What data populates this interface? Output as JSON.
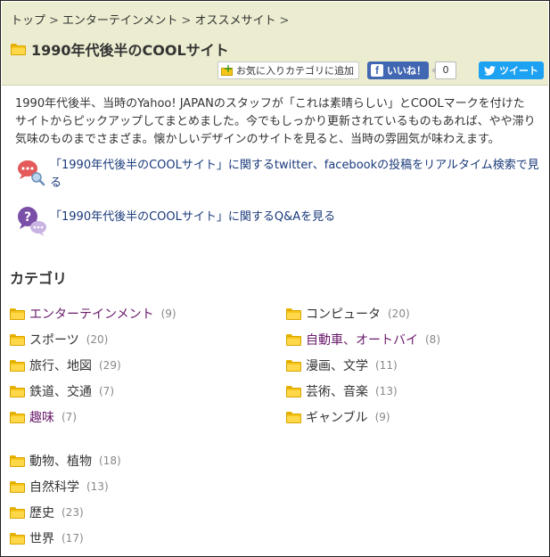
{
  "breadcrumb": {
    "items": [
      "トップ",
      "エンターテインメント",
      "オススメサイト"
    ],
    "separator": ">"
  },
  "page": {
    "title": "1990年代後半のCOOLサイト"
  },
  "toolbar": {
    "favorite_label": "お気に入りカテゴリに追加",
    "like_label": "いいね！",
    "like_count": "0",
    "tweet_label": "ツイート"
  },
  "description": {
    "lines": [
      "1990年代後半、当時のYahoo! JAPANのスタッフが「これは素晴らしい」とCOOLマークを付けた",
      "サイトからピックアップしてまとめました。今でもしっかり更新されているものもあれば、やや滞り",
      "気味のものまでさまざま。懐かしいデザインのサイトを見ると、当時の雰囲気が味わえます。"
    ]
  },
  "links": {
    "realtime_search": {
      "line1": "「1990年代後半のCOOLサイト」に関するtwitter、facebookの投稿をリアルタイム検索で見",
      "line2": "る"
    },
    "qa": "「1990年代後半のCOOLサイト」に関するQ&Aを見る"
  },
  "categories": {
    "heading": "カテゴリ",
    "left": [
      {
        "label": "エンターテインメント",
        "count": "(9)",
        "visited": true
      },
      {
        "label": "スポーツ",
        "count": "(20)",
        "visited": false
      },
      {
        "label": "旅行、地図",
        "count": "(29)",
        "visited": false
      },
      {
        "label": "鉄道、交通",
        "count": "(7)",
        "visited": false
      },
      {
        "label": "趣味",
        "count": "(7)",
        "visited": true
      }
    ],
    "right": [
      {
        "label": "コンピュータ",
        "count": "(20)",
        "visited": false
      },
      {
        "label": "自動車、オートバイ",
        "count": "(8)",
        "visited": true
      },
      {
        "label": "漫画、文学",
        "count": "(11)",
        "visited": false
      },
      {
        "label": "芸術、音楽",
        "count": "(13)",
        "visited": false
      },
      {
        "label": "ギャンブル",
        "count": "(9)",
        "visited": false
      }
    ],
    "bottom": [
      {
        "label": "動物、植物",
        "count": "(18)",
        "visited": false
      },
      {
        "label": "自然科学",
        "count": "(13)",
        "visited": false
      },
      {
        "label": "歴史",
        "count": "(23)",
        "visited": false
      },
      {
        "label": "世界",
        "count": "(17)",
        "visited": false
      }
    ]
  },
  "colors": {
    "header_bg": "#ececd0",
    "link": "#1a3a7a",
    "visited_link": "#6a1a6a",
    "facebook": "#4267b2",
    "twitter": "#1da1f2"
  }
}
